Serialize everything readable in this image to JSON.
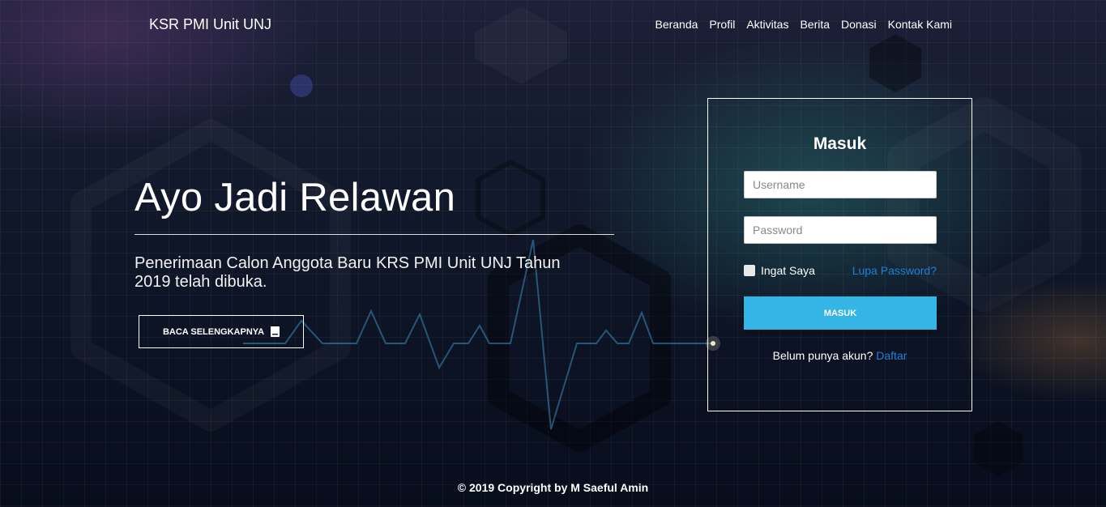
{
  "nav": {
    "brand": "KSR PMI Unit UNJ",
    "items": [
      "Beranda",
      "Profil",
      "Aktivitas",
      "Berita",
      "Donasi",
      "Kontak Kami"
    ]
  },
  "hero": {
    "title": "Ayo Jadi Relawan",
    "subtitle": "Penerimaan Calon Anggota Baru KRS PMI Unit UNJ Tahun 2019 telah dibuka.",
    "cta_label": "BACA SELENGKAPNYA",
    "cta_icon": "book-icon"
  },
  "login": {
    "title": "Masuk",
    "username_placeholder": "Username",
    "password_placeholder": "Password",
    "remember_label": "Ingat Saya",
    "forgot_label": "Lupa Password?",
    "submit_label": "MASUK",
    "register_text": "Belum punya akun?",
    "register_link": "Daftar"
  },
  "footer": {
    "copyright": "© 2019 Copyright by M Saeful Amin"
  },
  "colors": {
    "accent": "#35b5e6",
    "link": "#1e7fd8",
    "background": "#0c1426"
  }
}
